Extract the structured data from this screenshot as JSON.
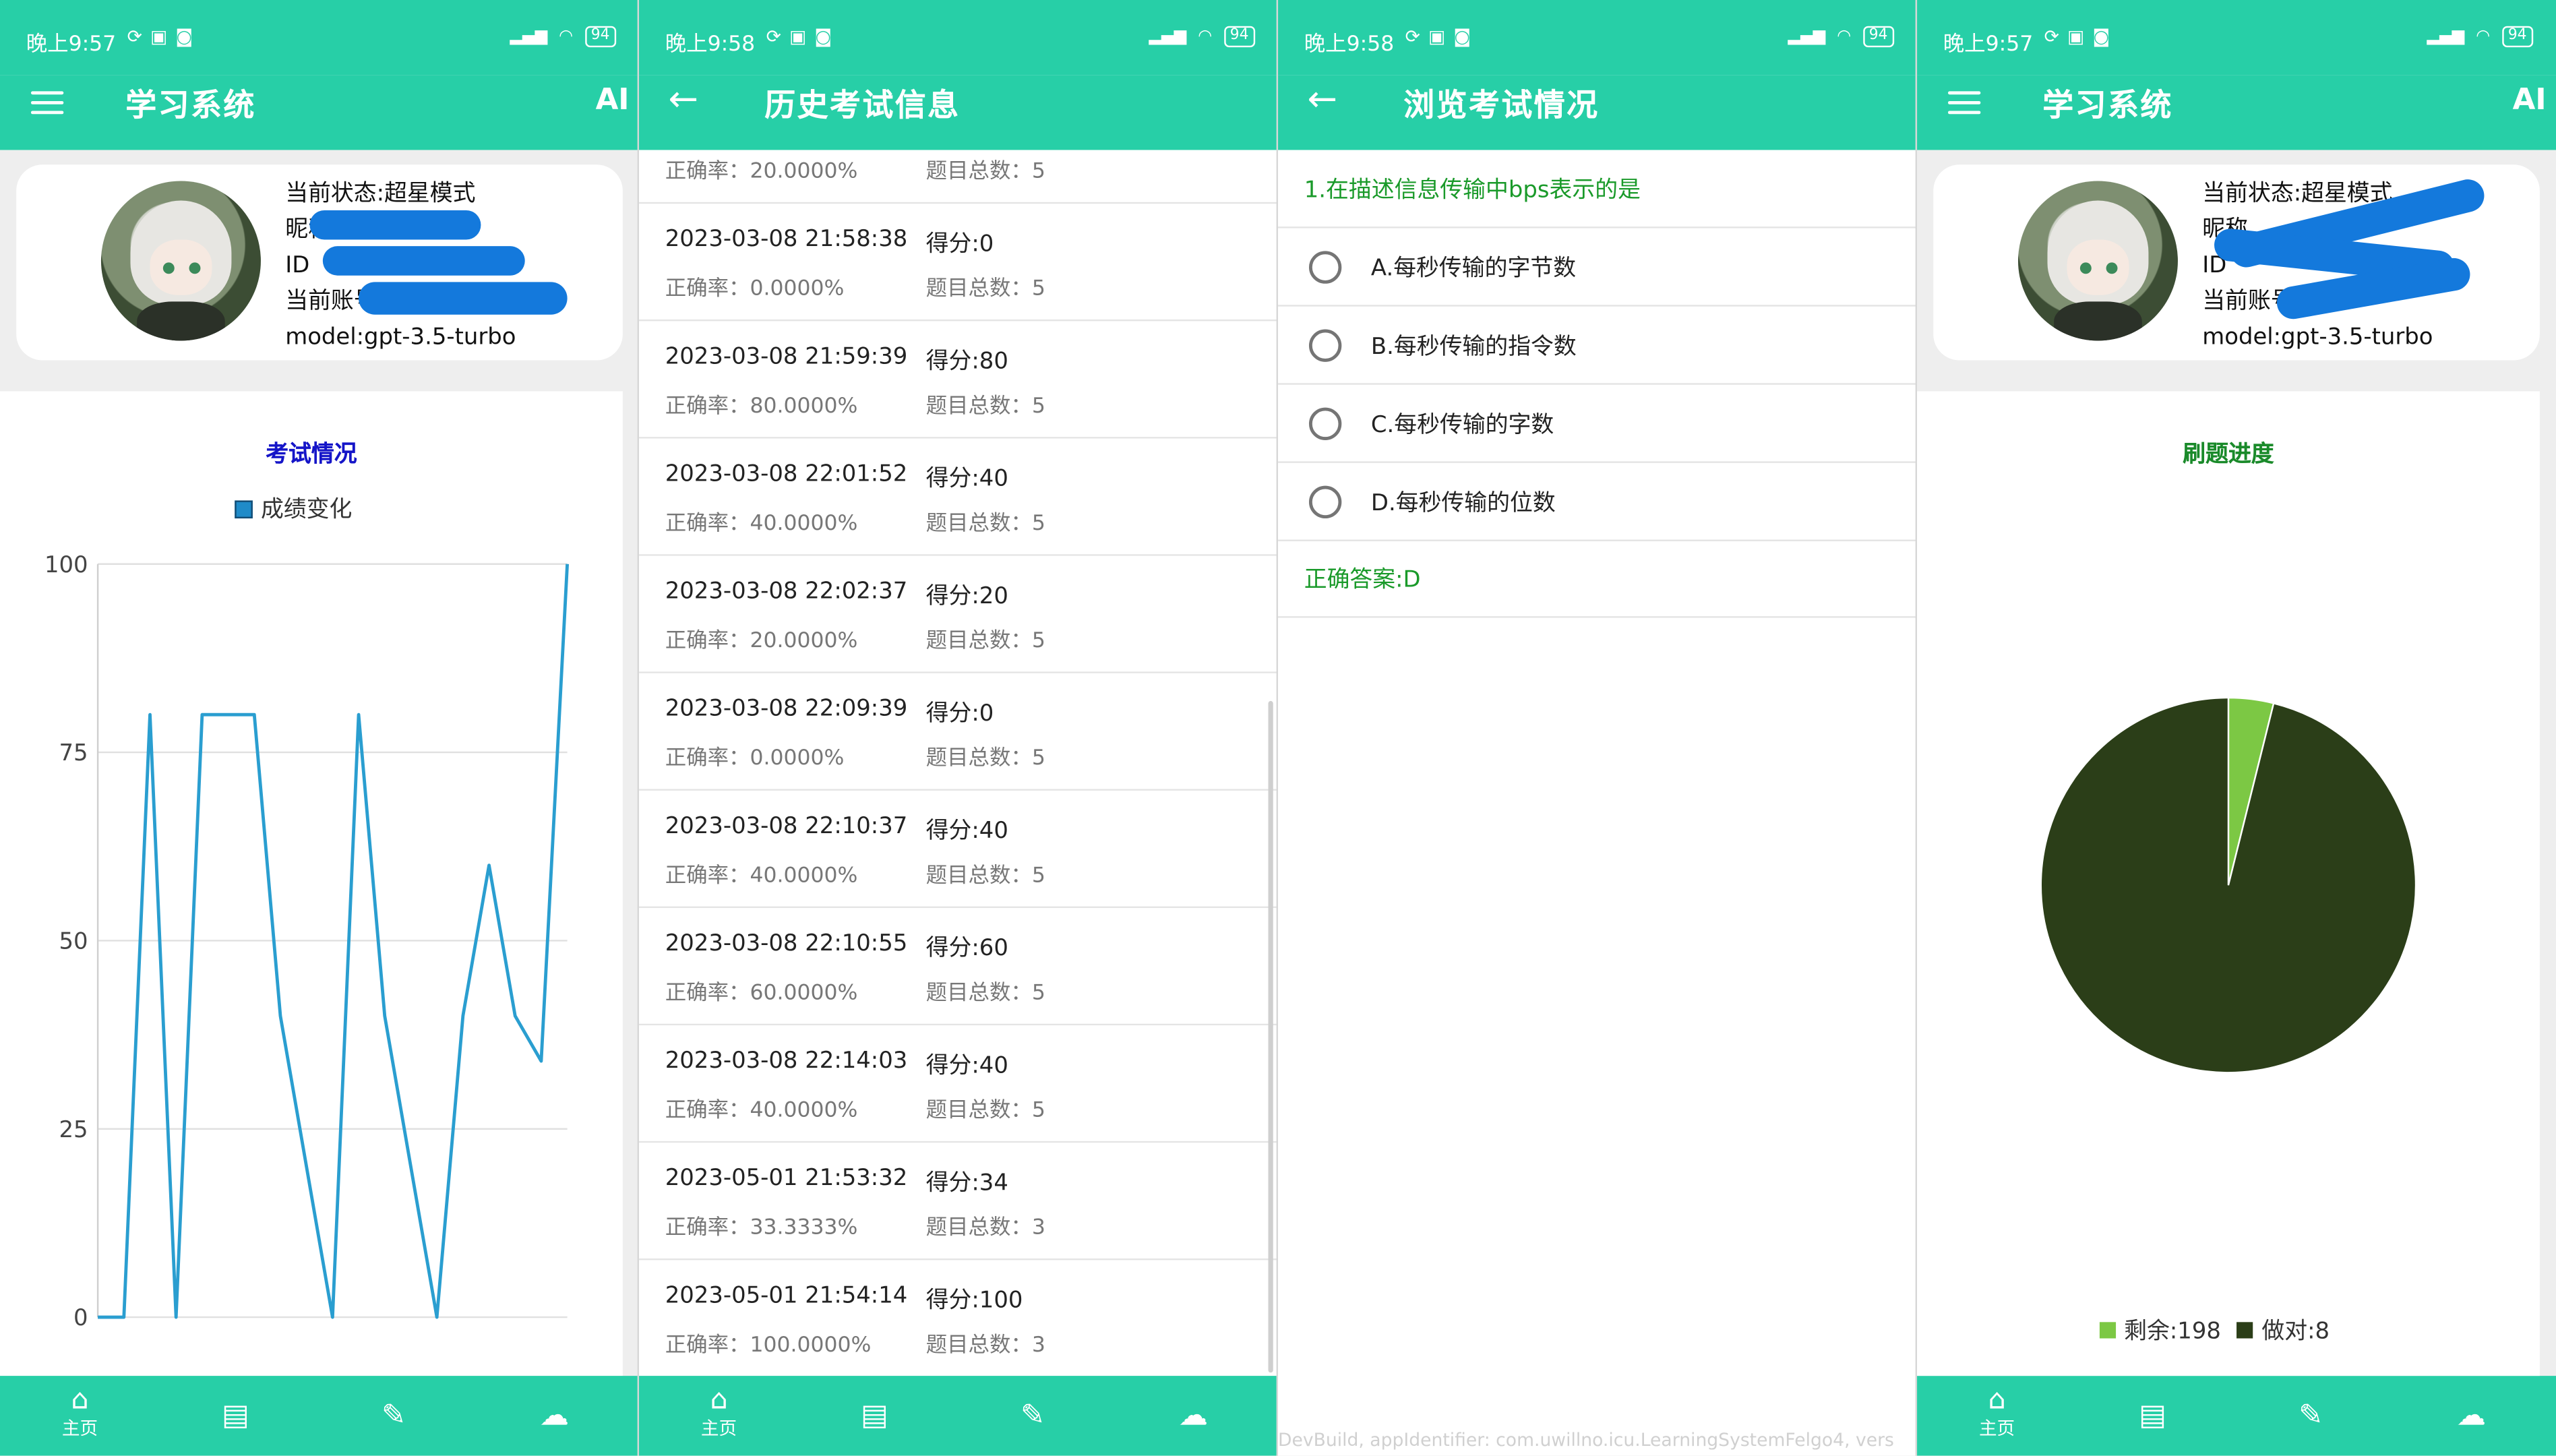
{
  "screens": {
    "home": {
      "status": {
        "time": "晚上9:57",
        "battery": "94"
      },
      "app_title": "学习系统",
      "ai_label": "AI",
      "profile": {
        "state": "当前状态:超星模式",
        "nickname_label": "昵称",
        "id_label": "ID",
        "account_label": "当前账号",
        "model": "model:gpt-3.5-turbo"
      },
      "chart_title": "考试情况",
      "legend": "成绩变化",
      "nav_home": "主页"
    },
    "history": {
      "status": {
        "time": "晚上9:58",
        "battery": "94"
      },
      "title": "历史考试信息",
      "rows": [
        {
          "datetime": "",
          "score": "",
          "rate": "正确率：20.0000%",
          "total": "题目总数：5"
        },
        {
          "datetime": "2023-03-08 21:58:38",
          "score": "得分:0",
          "rate": "正确率：0.0000%",
          "total": "题目总数：5"
        },
        {
          "datetime": "2023-03-08 21:59:39",
          "score": "得分:80",
          "rate": "正确率：80.0000%",
          "total": "题目总数：5"
        },
        {
          "datetime": "2023-03-08 22:01:52",
          "score": "得分:40",
          "rate": "正确率：40.0000%",
          "total": "题目总数：5"
        },
        {
          "datetime": "2023-03-08 22:02:37",
          "score": "得分:20",
          "rate": "正确率：20.0000%",
          "total": "题目总数：5"
        },
        {
          "datetime": "2023-03-08 22:09:39",
          "score": "得分:0",
          "rate": "正确率：0.0000%",
          "total": "题目总数：5"
        },
        {
          "datetime": "2023-03-08 22:10:37",
          "score": "得分:40",
          "rate": "正确率：40.0000%",
          "total": "题目总数：5"
        },
        {
          "datetime": "2023-03-08 22:10:55",
          "score": "得分:60",
          "rate": "正确率：60.0000%",
          "total": "题目总数：5"
        },
        {
          "datetime": "2023-03-08 22:14:03",
          "score": "得分:40",
          "rate": "正确率：40.0000%",
          "total": "题目总数：5"
        },
        {
          "datetime": "2023-05-01 21:53:32",
          "score": "得分:34",
          "rate": "正确率：33.3333%",
          "total": "题目总数：3"
        },
        {
          "datetime": "2023-05-01 21:54:14",
          "score": "得分:100",
          "rate": "正确率：100.0000%",
          "total": "题目总数：3"
        }
      ],
      "nav_home": "主页"
    },
    "review": {
      "status": {
        "time": "晚上9:58",
        "battery": "94"
      },
      "title": "浏览考试情况",
      "question": "1.在描述信息传输中bps表示的是",
      "options": [
        "A.每秒传输的字节数",
        "B.每秒传输的指令数",
        "C.每秒传输的字数",
        "D.每秒传输的位数"
      ],
      "answer": "正确答案:D",
      "devbuild": "DevBuild, appIdentifier: com.uwillno.icu.LearningSystemFelgo4, vers"
    },
    "progress": {
      "status": {
        "time": "晚上9:57",
        "battery": "94"
      },
      "app_title": "学习系统",
      "ai_label": "AI",
      "profile": {
        "state": "当前状态:超星模式",
        "nickname_label": "昵称",
        "id_label": "ID",
        "account_label": "当前账号",
        "model": "model:gpt-3.5-turbo"
      },
      "chart_title": "刷题进度",
      "nav_home": "主页"
    }
  },
  "colors": {
    "primary": "#27cfa7",
    "line": "#2a9ed0",
    "pie_remaining": "#7cc844",
    "pie_correct": "#2b3e18"
  },
  "chart_data": [
    {
      "type": "line",
      "title": "考试情况",
      "series": [
        {
          "name": "成绩变化",
          "values": [
            0,
            0,
            80,
            0,
            80,
            80,
            80,
            40,
            20,
            0,
            80,
            40,
            20,
            0,
            40,
            60,
            40,
            34,
            100
          ]
        }
      ],
      "ylim": [
        0,
        100
      ],
      "yticks": [
        0,
        25,
        50,
        75,
        100
      ],
      "grid": true,
      "legend": "top"
    },
    {
      "type": "pie",
      "title": "刷题进度",
      "slices": [
        {
          "label": "剩余:198",
          "value": 8,
          "color": "#7cc844"
        },
        {
          "label": "做对:8",
          "value": 198,
          "color": "#2b3e18"
        }
      ],
      "legend": "bottom"
    }
  ]
}
